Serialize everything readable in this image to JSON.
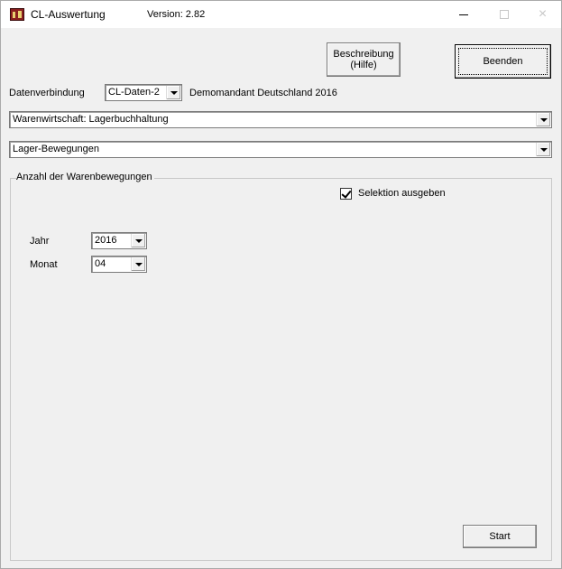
{
  "window": {
    "title": "CL-Auswertung",
    "version": "Version: 2.82",
    "controls": {
      "minimize": "–",
      "maximize": "",
      "close": "×"
    }
  },
  "buttons": {
    "help_line1": "Beschreibung",
    "help_line2": "(Hilfe)",
    "quit": "Beenden",
    "start": "Start"
  },
  "connection": {
    "label": "Datenverbindung",
    "value": "CL-Daten-2",
    "client": "Demomandant Deutschland 2016"
  },
  "module_select": {
    "value": "Warenwirtschaft: Lagerbuchhaltung"
  },
  "report_select": {
    "value": "Lager-Bewegungen"
  },
  "group": {
    "title": "Anzahl der Warenbewegungen",
    "checkbox_label": "Selektion ausgeben",
    "checkbox_checked": true,
    "year_label": "Jahr",
    "year_value": "2016",
    "month_label": "Monat",
    "month_value": "04"
  }
}
